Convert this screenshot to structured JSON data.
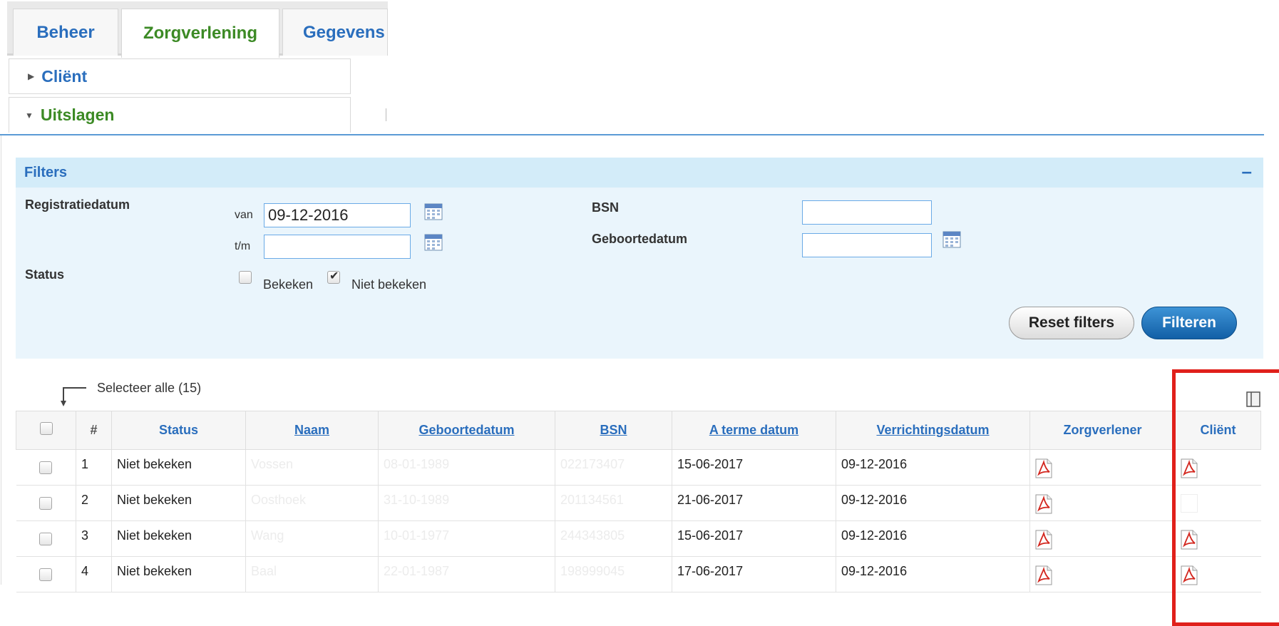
{
  "tabs": [
    {
      "label": "Beheer",
      "active": false
    },
    {
      "label": "Zorgverlening",
      "active": true
    },
    {
      "label": "Gegevens",
      "active": false
    }
  ],
  "accordion": {
    "client": {
      "label": "Cliënt",
      "expanded": false
    },
    "uitslagen": {
      "label": "Uitslagen",
      "expanded": true
    }
  },
  "filters": {
    "title": "Filters",
    "collapse_symbol": "–",
    "registratiedatum": {
      "label": "Registratiedatum",
      "van_label": "van",
      "van_value": "09-12-2016",
      "tm_label": "t/m",
      "tm_value": ""
    },
    "status": {
      "label": "Status",
      "options": [
        {
          "label": "Bekeken",
          "checked": false
        },
        {
          "label": "Niet bekeken",
          "checked": true
        }
      ]
    },
    "bsn": {
      "label": "BSN",
      "value": ""
    },
    "geboortedatum": {
      "label": "Geboortedatum",
      "value": ""
    },
    "reset_label": "Reset filters",
    "filter_label": "Filteren"
  },
  "select_all_label": "Selecteer alle (15)",
  "table": {
    "columns": [
      "#",
      "Status",
      "Naam",
      "Geboortedatum",
      "BSN",
      "A terme datum",
      "Verrichtingsdatum",
      "Zorgverlener",
      "Cliënt"
    ],
    "rows": [
      {
        "nr": "1",
        "status": "Niet bekeken",
        "naam": "Vossen",
        "geboortedatum": "08-01-1989",
        "bsn": "022173407",
        "a_terme": "15-06-2017",
        "verrichting": "09-12-2016",
        "client_pdf": true
      },
      {
        "nr": "2",
        "status": "Niet bekeken",
        "naam": "Oosthoek",
        "geboortedatum": "31-10-1989",
        "bsn": "201134561",
        "a_terme": "21-06-2017",
        "verrichting": "09-12-2016",
        "client_pdf": false
      },
      {
        "nr": "3",
        "status": "Niet bekeken",
        "naam": "Wang",
        "geboortedatum": "10-01-1977",
        "bsn": "244343805",
        "a_terme": "15-06-2017",
        "verrichting": "09-12-2016",
        "client_pdf": true
      },
      {
        "nr": "4",
        "status": "Niet bekeken",
        "naam": "Baal",
        "geboortedatum": "22-01-1987",
        "bsn": "198999045",
        "a_terme": "17-06-2017",
        "verrichting": "09-12-2016",
        "client_pdf": true
      }
    ]
  },
  "colors": {
    "accent_blue": "#2a6ebd",
    "active_green": "#3c8a25",
    "filter_bg": "#eaf5fc",
    "annotation_red": "#e0201b"
  },
  "icons": {
    "calendar": "calendar-icon",
    "pdf": "pdf-icon",
    "grid": "column-settings-icon"
  }
}
